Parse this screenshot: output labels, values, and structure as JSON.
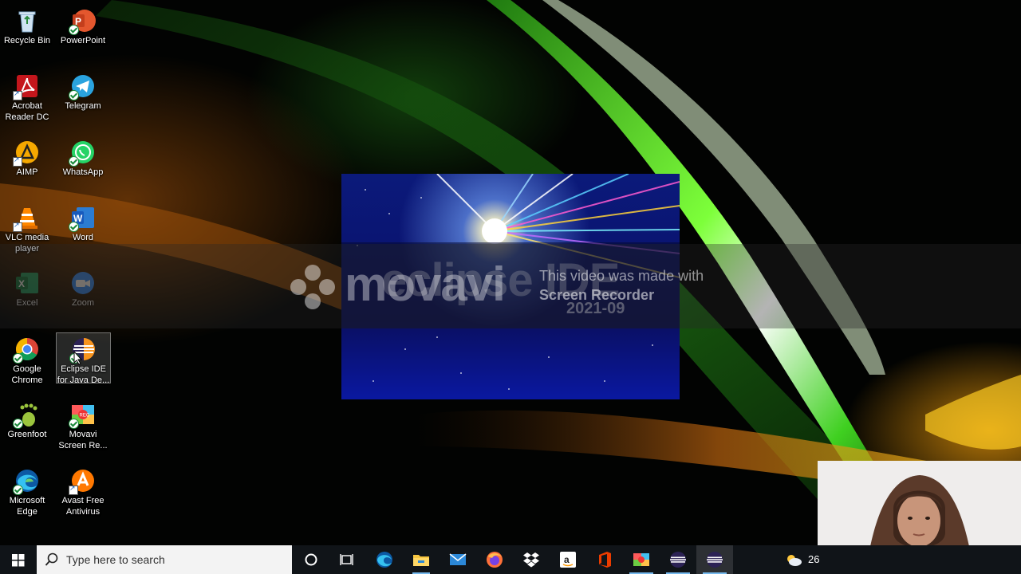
{
  "desktop": {
    "icons": [
      {
        "label": "Recycle Bin",
        "icon": "recycle-bin-icon"
      },
      {
        "label": "PowerPoint",
        "icon": "powerpoint-icon"
      },
      {
        "label": "Acrobat Reader DC",
        "icon": "acrobat-reader-icon"
      },
      {
        "label": "Telegram",
        "icon": "telegram-icon"
      },
      {
        "label": "AIMP",
        "icon": "aimp-icon"
      },
      {
        "label": "WhatsApp",
        "icon": "whatsapp-icon"
      },
      {
        "label": "VLC media player",
        "icon": "vlc-icon"
      },
      {
        "label": "Word",
        "icon": "word-icon"
      },
      {
        "label": "Excel",
        "icon": "excel-icon"
      },
      {
        "label": "Zoom",
        "icon": "zoom-icon"
      },
      {
        "label": "Google Chrome",
        "icon": "chrome-icon"
      },
      {
        "label": "Eclipse IDE for Java De...",
        "icon": "eclipse-icon",
        "selected": true
      },
      {
        "label": "Greenfoot",
        "icon": "greenfoot-icon"
      },
      {
        "label": "Movavi Screen Re...",
        "icon": "movavi-icon"
      },
      {
        "label": "Microsoft Edge",
        "icon": "edge-icon"
      },
      {
        "label": "Avast Free Antivirus",
        "icon": "avast-icon"
      }
    ]
  },
  "splash": {
    "title": "eclipse IDE",
    "version": "2021-09"
  },
  "watermark": {
    "brand": "movavi",
    "line1": "This video was made with",
    "line2": "Screen Recorder"
  },
  "taskbar": {
    "search_placeholder": "Type here to search",
    "apps": [
      "cortana-icon",
      "task-view-icon",
      "edge-icon",
      "file-explorer-icon",
      "mail-icon",
      "firefox-icon",
      "dropbox-icon",
      "amazon-icon",
      "office-icon",
      "movavi-icon",
      "eclipse-icon",
      "eclipse-icon"
    ],
    "tray_temp": "26"
  },
  "colors": {
    "taskbar_bg": "#101418",
    "accent": "#76b9ed",
    "splash_blue": "#0a1370"
  }
}
